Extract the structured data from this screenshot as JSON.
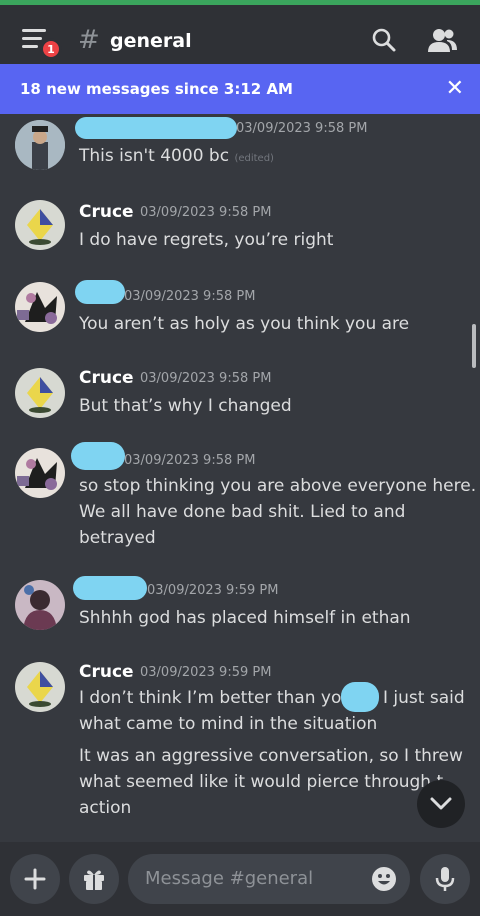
{
  "topbar": {
    "channel_hash": "#",
    "channel_name": "general",
    "notif_count": "1"
  },
  "banner": {
    "text": "18 new messages since 3:12 AM",
    "close": "✕"
  },
  "messages": [
    {
      "user": "",
      "time": "03/09/2023 9:58 PM",
      "lines": [
        "This isn't 4000 bc"
      ],
      "edited": "(edited)"
    },
    {
      "user": "Cruce",
      "time": "03/09/2023 9:58 PM",
      "lines": [
        "I do have regrets, you’re right"
      ]
    },
    {
      "user": "",
      "time": "03/09/2023 9:58 PM",
      "lines": [
        "You aren’t as holy as you think you are"
      ]
    },
    {
      "user": "Cruce",
      "time": "03/09/2023 9:58 PM",
      "lines": [
        "But that’s why I changed"
      ]
    },
    {
      "user": "",
      "time": "03/09/2023 9:58 PM",
      "lines": [
        "so stop thinking you are above everyone here.",
        "We all have done bad shit. Lied to and",
        "betrayed"
      ]
    },
    {
      "user": "",
      "time": "03/09/2023 9:59 PM",
      "lines": [
        "Shhhh god has placed himself in ethan"
      ]
    },
    {
      "user": "Cruce",
      "time": "03/09/2023 9:59 PM",
      "lines": [
        "I don’t think I’m better than you",
        "I just said",
        "what came to mind in the situation",
        "It was an aggressive conversation, so I threw",
        "what seemed like it would pierce through t",
        "action"
      ]
    }
  ],
  "composer": {
    "placeholder": "Message #general"
  },
  "icons": {
    "menu": "hamburger-menu-icon",
    "search": "search-icon",
    "members": "members-icon",
    "add": "plus-icon",
    "gift": "gift-icon",
    "emoji": "emoji-icon",
    "mic": "microphone-icon",
    "jump": "chevron-down-icon"
  },
  "colors": {
    "accent": "#5865f2",
    "background": "#36393f",
    "topbar": "#2f3136",
    "badge": "#ed4245",
    "status_strip": "#3ba55d"
  }
}
